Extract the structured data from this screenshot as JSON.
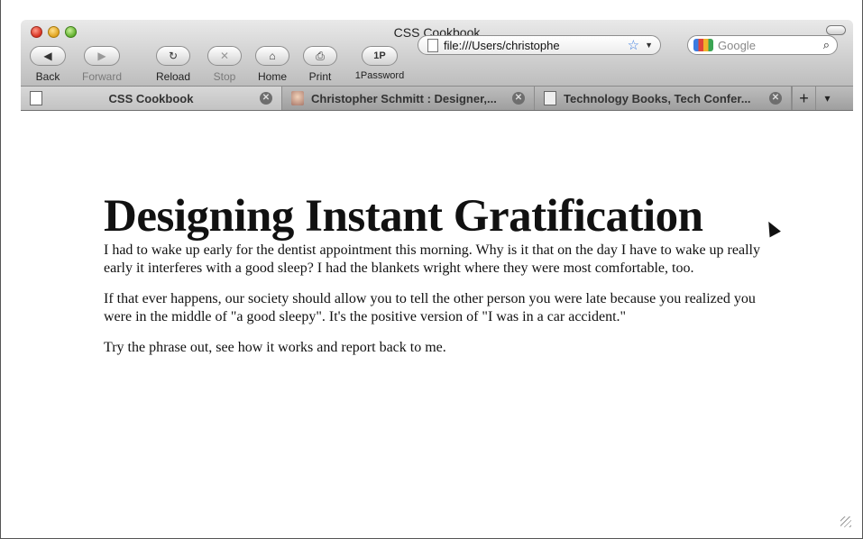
{
  "window": {
    "title": "CSS Cookbook"
  },
  "toolbar": {
    "back_label": "Back",
    "forward_label": "Forward",
    "reload_label": "Reload",
    "stop_label": "Stop",
    "home_label": "Home",
    "print_label": "Print",
    "onepassword_label": "1Password",
    "onepassword_badge": "1P"
  },
  "address_bar": {
    "url": "file:///Users/christophe"
  },
  "search": {
    "placeholder": "Google"
  },
  "tabs": [
    {
      "title": "CSS Cookbook",
      "icon": "document-icon",
      "active": true
    },
    {
      "title": "Christopher Schmitt : Designer,...",
      "icon": "portrait-icon",
      "active": false
    },
    {
      "title": "Technology Books, Tech Confer...",
      "icon": "oreilly-icon",
      "active": false
    }
  ],
  "page": {
    "heading": "Designing Instant Gratification",
    "paragraphs": [
      "I had to wake up early for the dentist appointment this morning. Why is it that on the day I have to wake up really early it interferes with a good sleep? I had the blankets wright where they were most comfortable, too.",
      "If that ever happens, our society should allow you to tell the other person you were late because you realized you were in the middle of \"a good sleepy\". It's the positive version of \"I was in a car accident.\"",
      "Try the phrase out, see how it works and report back to me."
    ]
  },
  "colors": {
    "close": "#d6301f",
    "minimize": "#e0a21c",
    "zoom": "#5fae2c",
    "star": "#3a7be0"
  }
}
